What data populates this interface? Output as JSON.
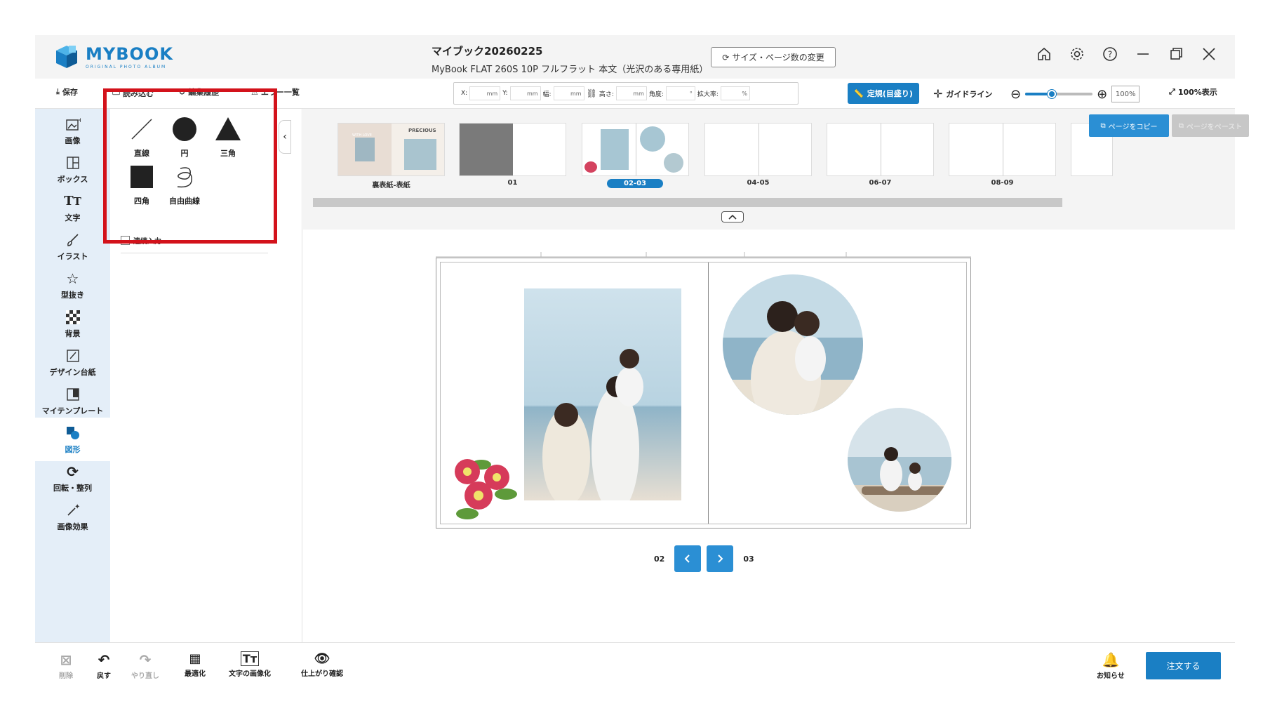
{
  "app": {
    "logo_text": "MYBOOK",
    "logo_sub": "ORIGINAL PHOTO ALBUM",
    "doc_title": "マイブック20260225",
    "doc_subtitle": "MyBook FLAT 260S 10P フルフラット 本文（光沢のある専用紙）",
    "size_button": "サイズ・ページ数の変更",
    "window_icons": [
      "home-icon",
      "gear-icon",
      "help-icon",
      "minimize-icon",
      "restore-icon",
      "close-icon"
    ]
  },
  "toolbar": {
    "save": "保存",
    "load": "読み込む",
    "history": "編集履歴",
    "errors": "エラー一覧",
    "fields": {
      "x_label": "X:",
      "y_label": "Y:",
      "w_label": "幅:",
      "h_label": "高さ:",
      "angle_label": "角度:",
      "scale_label": "拡大率:",
      "mm": "mm",
      "deg": "°",
      "pct": "%"
    },
    "ruler_button": "定規(目盛り)",
    "guideline": "ガイドライン",
    "zoom_value": "100%",
    "zoom_level": 0.4,
    "full_view": "100%表示"
  },
  "sidebar": {
    "items": [
      {
        "label": "画像",
        "icon": "image-add-icon"
      },
      {
        "label": "ボックス",
        "icon": "box-layout-icon"
      },
      {
        "label": "文字",
        "icon": "text-icon"
      },
      {
        "label": "イラスト",
        "icon": "brush-icon"
      },
      {
        "label": "型抜き",
        "icon": "star-cut-icon"
      },
      {
        "label": "背景",
        "icon": "background-icon"
      },
      {
        "label": "デザイン台紙",
        "icon": "design-mount-icon"
      },
      {
        "label": "マイテンプレート",
        "icon": "template-icon"
      },
      {
        "label": "図形",
        "icon": "shapes-icon"
      },
      {
        "label": "回転・整列",
        "icon": "rotate-align-icon"
      },
      {
        "label": "画像効果",
        "icon": "magic-wand-icon"
      }
    ],
    "active_index": 8
  },
  "shapes": {
    "line": "直線",
    "circle": "円",
    "triangle": "三角",
    "square": "四角",
    "freeform": "自由曲線",
    "continuous": "連続入力"
  },
  "strip": {
    "pages": [
      "裏表紙-表紙",
      "01",
      "02-03",
      "04-05",
      "06-07",
      "08-09"
    ],
    "selected": "02-03",
    "copy_button": "ページをコピー",
    "paste_button": "ページをペースト",
    "cover_text": "PRECIOUS",
    "cover_text2": "WITH LOVE"
  },
  "canvas": {
    "page_left": "02",
    "page_right": "03"
  },
  "bottom": {
    "delete": "削除",
    "undo": "戻す",
    "redo": "やり直し",
    "optimize": "最適化",
    "text_to_image": "文字の画像化",
    "preview": "仕上がり確認",
    "notifications": "お知らせ",
    "order": "注文する"
  },
  "colors": {
    "accent": "#1a7fc4",
    "highlight_frame": "#d3121b"
  }
}
